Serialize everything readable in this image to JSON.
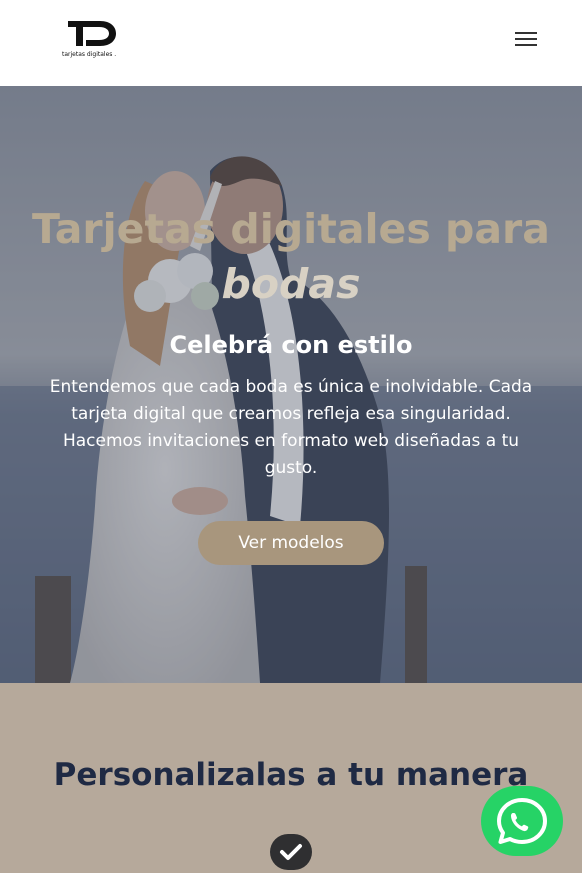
{
  "header": {
    "logo_letters": "TD",
    "logo_text": "tarjetas digitales .",
    "menu_icon": "hamburger-menu-icon"
  },
  "hero": {
    "title_line1": "Tarjetas digitales para",
    "title_line2": "bodas",
    "subtitle": "Celebrá con estilo",
    "body": "Entendemos que cada boda es única e inolvidable. Cada tarjeta digital que creamos refleja esa singularidad. Hacemos invitaciones en formato web diseñadas a tu gusto.",
    "cta_label": "Ver modelos",
    "background_image": "wedding-couple-photo"
  },
  "section": {
    "title": "Personalizalas a tu manera",
    "badge_icon": "checkmark-icon"
  },
  "floating": {
    "whatsapp_icon": "whatsapp-icon"
  },
  "colors": {
    "accent": "#a8967d",
    "title_gold": "#b7a991",
    "section_bg": "#b6a99b",
    "section_title": "#1f2a44",
    "whatsapp_green": "#26d366"
  }
}
